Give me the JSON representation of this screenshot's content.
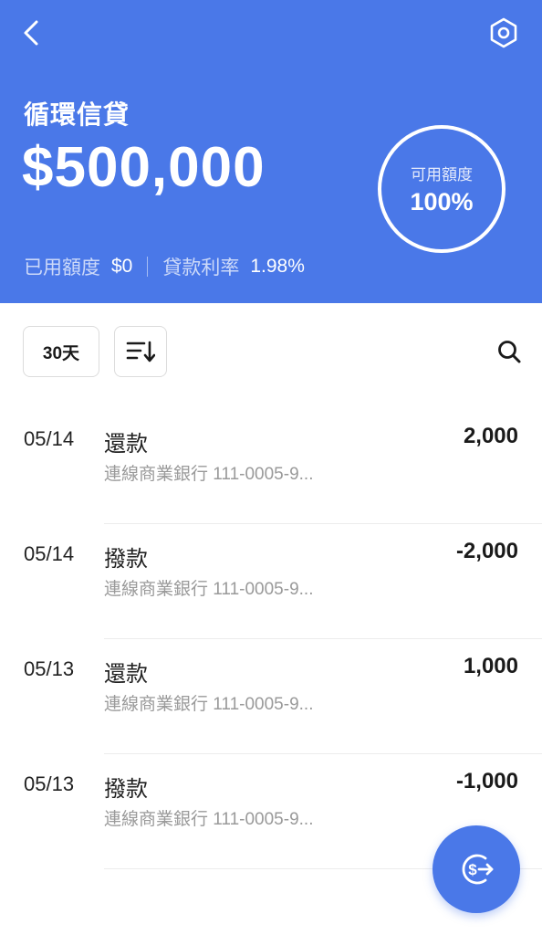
{
  "header": {
    "title": "循環信貸",
    "amount": "$500,000",
    "ring": {
      "label": "可用額度",
      "value": "100%"
    },
    "stats": {
      "used_label": "已用額度",
      "used_value": "$0",
      "rate_label": "貸款利率",
      "rate_value": "1.98%"
    },
    "back_icon": "chevron-left-icon",
    "settings_icon": "hexagon-settings-icon",
    "background_color": "#4a78e8"
  },
  "toolbar": {
    "filter_label": "30天",
    "sort_icon": "sort-descending-icon",
    "search_icon": "search-icon"
  },
  "transactions": [
    {
      "date": "05/14",
      "type": "還款",
      "description": "連線商業銀行 111-0005-9...",
      "amount": "2,000"
    },
    {
      "date": "05/14",
      "type": "撥款",
      "description": "連線商業銀行 111-0005-9...",
      "amount": "-2,000"
    },
    {
      "date": "05/13",
      "type": "還款",
      "description": "連線商業銀行 111-0005-9...",
      "amount": "1,000"
    },
    {
      "date": "05/13",
      "type": "撥款",
      "description": "連線商業銀行 111-0005-9...",
      "amount": "-1,000"
    }
  ],
  "fab": {
    "icon": "dollar-transfer-icon"
  },
  "colors": {
    "accent": "#4a78e8",
    "muted_text": "#9a9a9a"
  }
}
